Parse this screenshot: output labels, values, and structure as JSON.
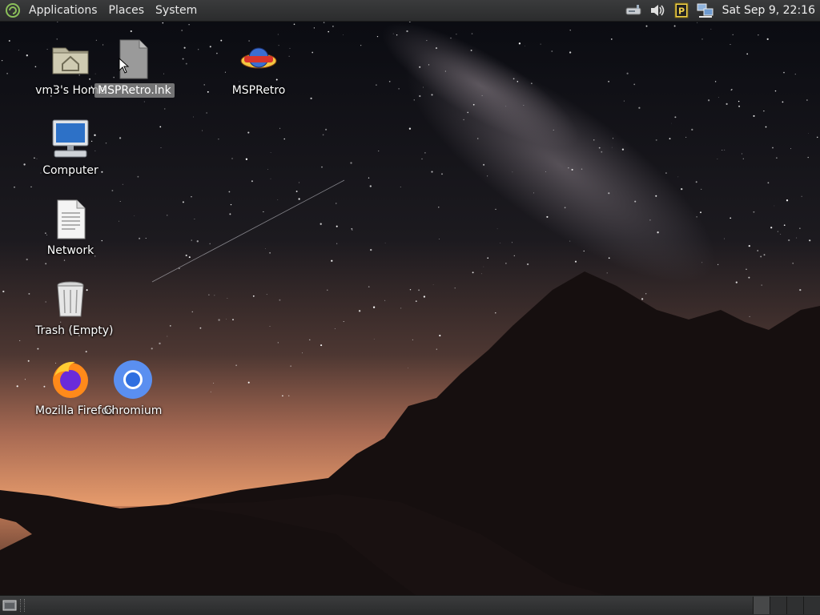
{
  "top_panel": {
    "menus": [
      "Applications",
      "Places",
      "System"
    ],
    "tray_icons": [
      "network-drive-icon",
      "volume-icon",
      "parcellite-icon",
      "network-connection-icon"
    ],
    "clock": "Sat Sep 9, 22:16"
  },
  "desktop": {
    "icons": [
      {
        "label": "vm3's Home",
        "icon": "home-folder-icon"
      },
      {
        "label": "MSPRetro.lnk",
        "icon": "file-icon",
        "selected": true
      },
      {
        "label": "MSPRetro",
        "icon": "msp-logo-icon"
      },
      {
        "label": "Computer",
        "icon": "computer-icon"
      },
      {
        "label": "Network",
        "icon": "document-icon"
      },
      {
        "label": "Trash (Empty)",
        "icon": "trash-icon"
      },
      {
        "label": "Mozilla Firefox",
        "icon": "firefox-icon"
      },
      {
        "label": "Chromium",
        "icon": "chromium-icon"
      }
    ]
  },
  "bottom_panel": {
    "workspace_count": 4,
    "active_workspace": 1
  },
  "colors": {
    "panel": "#2d2e2f",
    "selection": "#8f8f8f",
    "sky_top": "#0b0c12",
    "horizon_glow": "#e59a6b"
  }
}
